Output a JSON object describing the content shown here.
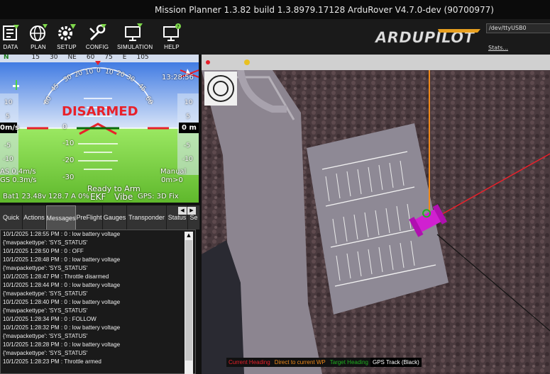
{
  "titlebar": {
    "title": "Mission Planner 1.3.82 build 1.3.8979.17128 ArduRover V4.7.0-dev (90700977)"
  },
  "toolbar": {
    "items": [
      {
        "label": "DATA",
        "icon": "data-icon"
      },
      {
        "label": "PLAN",
        "icon": "plan-icon"
      },
      {
        "label": "SETUP",
        "icon": "setup-icon"
      },
      {
        "label": "CONFIG",
        "icon": "config-icon"
      },
      {
        "label": "SIMULATION",
        "icon": "simulation-icon"
      },
      {
        "label": "HELP",
        "icon": "help-icon"
      }
    ],
    "logo_text": "ARDUPILOT",
    "port": "/dev/ttyUSB0",
    "stats_link": "Stats..."
  },
  "hud": {
    "status": "DISARMED",
    "time": "13:28:56",
    "heading_ticks": [
      "N",
      "15",
      "30",
      "NE",
      "60",
      "75",
      "E",
      "105"
    ],
    "roll_scale": [
      "60",
      "45",
      "30",
      "20",
      "10",
      "0",
      "10",
      "20",
      "30",
      "45",
      "60"
    ],
    "pitch_labels": [
      "0",
      "-10",
      "-20",
      "-30"
    ],
    "left_tape": [
      "10",
      "5",
      "-5",
      "-10"
    ],
    "right_tape": [
      "10",
      "5",
      "-5",
      "-10"
    ],
    "left_value": "0m/s",
    "right_value": "0 m",
    "airspeed": "AS 0.4m/s",
    "groundspeed": "GS 0.3m/s",
    "mode": "Manual",
    "wp_dist": "0m>0",
    "battery": "Bat1 23.48v 128.7 A 0%",
    "ready": "Ready to Arm",
    "ekf": "EKF",
    "vibe": "Vibe",
    "gps": "GPS: 3D Fix",
    "colors": {
      "sky": "#4d8fe8",
      "ground": "#7ed84b",
      "alert": "#e8212a"
    }
  },
  "tabs": {
    "items": [
      "Quick",
      "Actions",
      "Messages",
      "PreFlight",
      "Gauges",
      "Transponder",
      "Status",
      "Se"
    ],
    "active": "Messages",
    "arrow_left": "◀",
    "arrow_right": "▶"
  },
  "messages": [
    "10/1/2025 1:28:55 PM : 0 : low battery voltage",
    "{'mavpackettype': 'SYS_STATUS'",
    "10/1/2025 1:28:50 PM : 0 : OFF",
    "10/1/2025 1:28:48 PM : 0 : low battery voltage",
    "{'mavpackettype': 'SYS_STATUS'",
    "10/1/2025 1:28:47 PM : Throttle disarmed",
    "10/1/2025 1:28:44 PM : 0 : low battery voltage",
    "{'mavpackettype': 'SYS_STATUS'",
    "10/1/2025 1:28:40 PM : 0 : low battery voltage",
    "{'mavpackettype': 'SYS_STATUS'",
    "10/1/2025 1:28:34 PM : 0 : FOLLOW",
    "10/1/2025 1:28:32 PM : 0 : low battery voltage",
    "{'mavpackettype': 'SYS_STATUS'",
    "10/1/2025 1:28:28 PM : 0 : low battery voltage",
    "{'mavpackettype': 'SYS_STATUS'",
    "10/1/2025 1:28:23 PM : Throttle armed"
  ],
  "map": {
    "legend": [
      {
        "text": "Current Heading",
        "color": "#e8202a"
      },
      {
        "text": "Direct to current WP",
        "color": "#f08a1a"
      },
      {
        "text": "Target Heading",
        "color": "#20b020"
      },
      {
        "text": "GPS Track (Black)",
        "color": "#ffffff"
      }
    ]
  }
}
